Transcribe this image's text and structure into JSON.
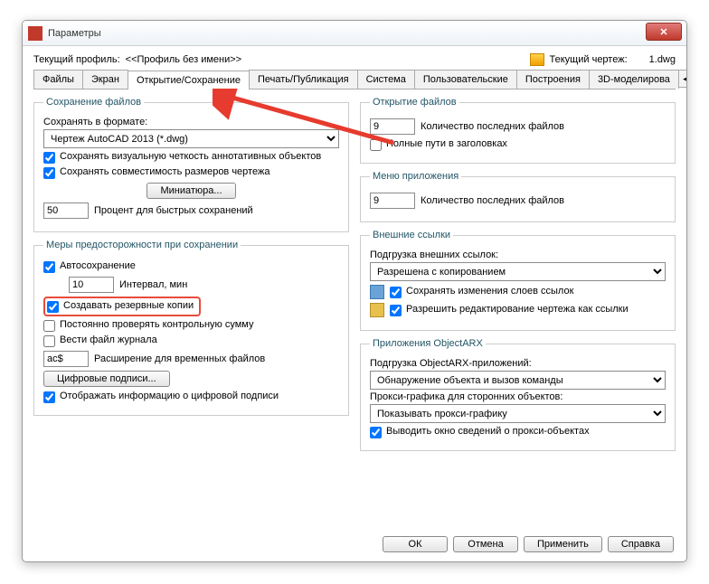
{
  "window": {
    "title": "Параметры"
  },
  "profile": {
    "label": "Текущий профиль:",
    "value": "<<Профиль без имени>>",
    "drawing_label": "Текущий чертеж:",
    "drawing_value": "1.dwg"
  },
  "tabs": {
    "files": "Файлы",
    "display": "Экран",
    "open_save": "Открытие/Сохранение",
    "plot": "Печать/Публикация",
    "system": "Система",
    "user": "Пользовательские",
    "draft": "Построения",
    "3d": "3D-моделирова"
  },
  "save": {
    "legend": "Сохранение файлов",
    "format_label": "Сохранять в формате:",
    "format_value": "Чертеж AutoCAD 2013 (*.dwg)",
    "annot_fidelity": "Сохранять визуальную четкость аннотативных объектов",
    "size_compat": "Сохранять совместимость размеров чертежа",
    "thumb_btn": "Миниатюра...",
    "percent_value": "50",
    "percent_label": "Процент для быстрых сохранений"
  },
  "safety": {
    "legend": "Меры предосторожности при сохранении",
    "autosave": "Автосохранение",
    "interval_value": "10",
    "interval_label": "Интервал, мин",
    "backup": "Создавать резервные копии",
    "crc": "Постоянно проверять контрольную сумму",
    "log": "Вести файл журнала",
    "ext_value": "ac$",
    "ext_label": "Расширение для временных файлов",
    "sig_btn": "Цифровые подписи...",
    "sig_info": "Отображать информацию о цифровой подписи"
  },
  "open": {
    "legend": "Открытие файлов",
    "recent_value": "9",
    "recent_label": "Количество последних файлов",
    "full_path": "Полные пути в заголовках"
  },
  "appmenu": {
    "legend": "Меню приложения",
    "recent_value": "9",
    "recent_label": "Количество последних файлов"
  },
  "xref": {
    "legend": "Внешние ссылки",
    "demand_label": "Подгрузка внешних ссылок:",
    "demand_value": "Разрешена с копированием",
    "retain_layers": "Сохранять изменения слоев ссылок",
    "allow_edit": "Разрешить редактирование чертежа как ссылки"
  },
  "arx": {
    "legend": "Приложения ObjectARX",
    "demand_label": "Подгрузка ObjectARX-приложений:",
    "demand_value": "Обнаружение объекта и вызов команды",
    "proxy_label": "Прокси-графика для сторонних объектов:",
    "proxy_value": "Показывать прокси-графику",
    "proxy_info": "Выводить окно сведений о прокси-объектах"
  },
  "buttons": {
    "ok": "ОК",
    "cancel": "Отмена",
    "apply": "Применить",
    "help": "Справка"
  }
}
